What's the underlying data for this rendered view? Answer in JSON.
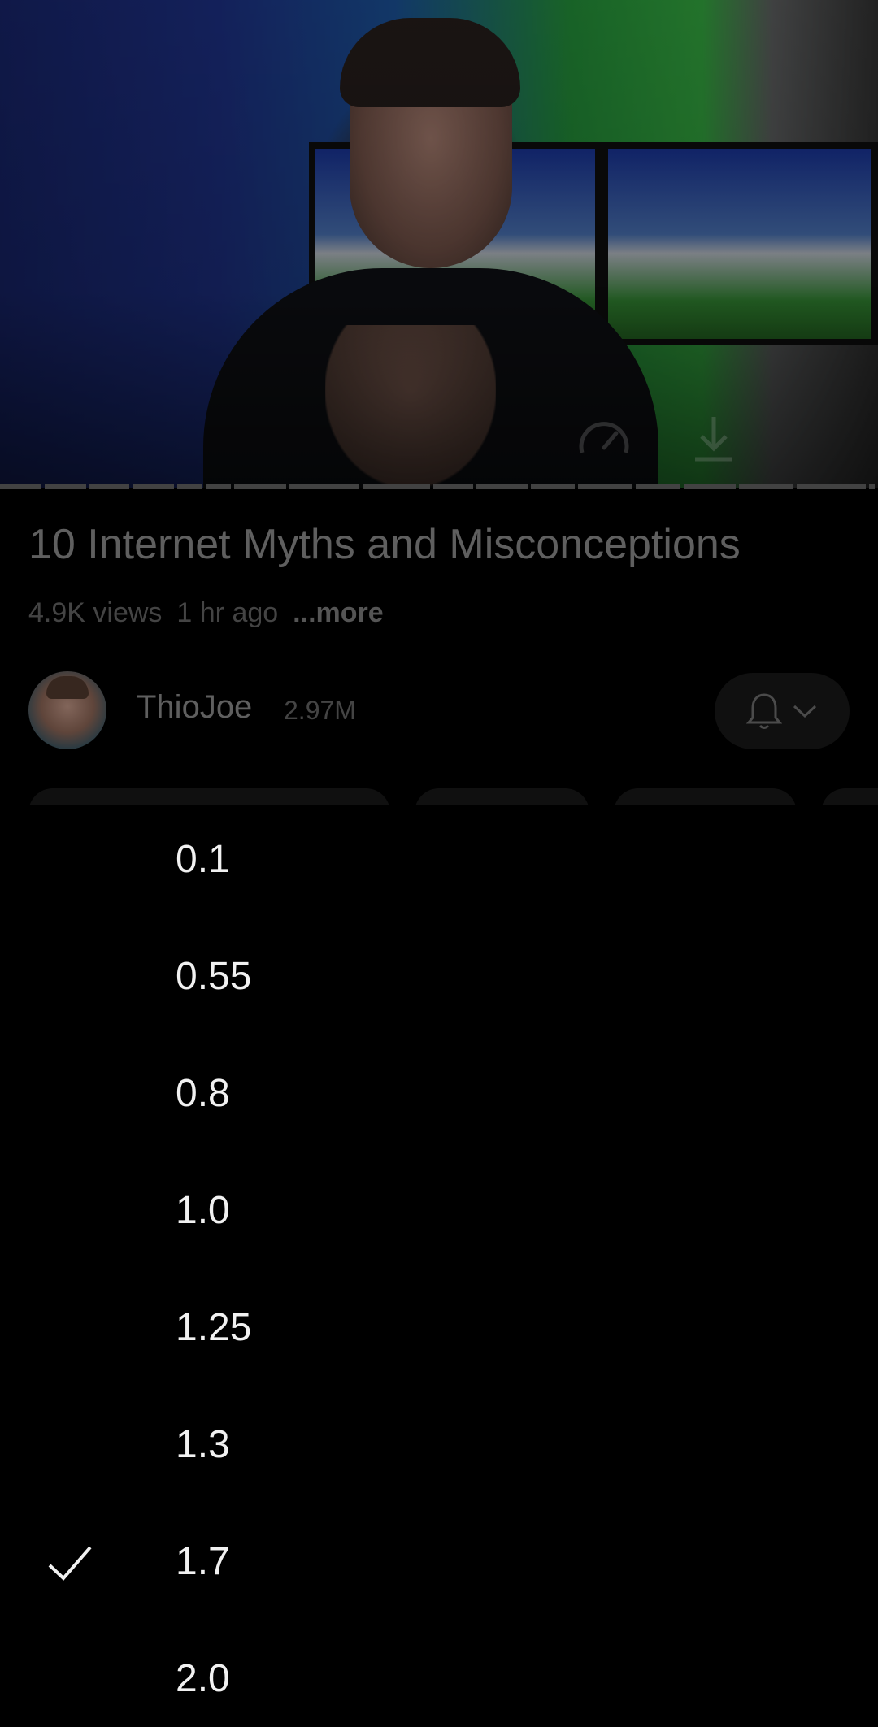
{
  "player": {
    "icons": [
      "speedometer-icon",
      "download-icon"
    ],
    "progress_segments": 18
  },
  "video": {
    "title": "10 Internet Myths and Misconceptions",
    "views": "4.9K views",
    "age": "1 hr ago",
    "more_label": "...more"
  },
  "channel": {
    "name": "ThioJoe",
    "subscribers": "2.97M",
    "subscribe_icons": [
      "bell-icon",
      "chevron-down-icon"
    ]
  },
  "speed_menu": {
    "options": [
      {
        "label": "0.1",
        "selected": false
      },
      {
        "label": "0.55",
        "selected": false
      },
      {
        "label": "0.8",
        "selected": false
      },
      {
        "label": "1.0",
        "selected": false
      },
      {
        "label": "1.25",
        "selected": false
      },
      {
        "label": "1.3",
        "selected": false
      },
      {
        "label": "1.7",
        "selected": true
      },
      {
        "label": "2.0",
        "selected": false
      }
    ],
    "selected_icon": "check-icon"
  },
  "colors": {
    "background": "#000000",
    "menu_text": "#f1f1f1",
    "dimmed_text": "#9a9a9a"
  }
}
